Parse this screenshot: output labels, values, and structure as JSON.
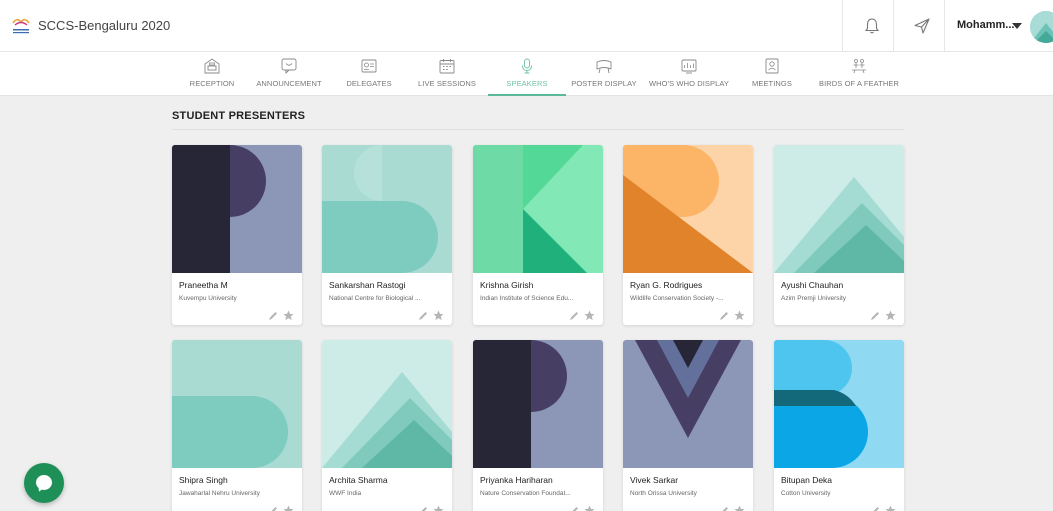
{
  "app": {
    "title": "SCCS-Bengaluru 2020",
    "logo_icon": "conference-logo-icon"
  },
  "header": {
    "user_name": "Mohamm...",
    "icons": [
      "bell-icon",
      "send-icon",
      "chevron-down-icon",
      "avatar"
    ]
  },
  "nav": {
    "items": [
      {
        "label": "RECEPTION",
        "icon": "reception-icon",
        "active": false
      },
      {
        "label": "ANNOUNCEMENT",
        "icon": "announcement-icon",
        "active": false
      },
      {
        "label": "DELEGATES",
        "icon": "delegates-icon",
        "active": false
      },
      {
        "label": "LIVE SESSIONS",
        "icon": "calendar-icon",
        "active": false
      },
      {
        "label": "SPEAKERS",
        "icon": "microphone-icon",
        "active": true
      },
      {
        "label": "POSTER DISPLAY",
        "icon": "poster-icon",
        "active": false
      },
      {
        "label": "WHO'S WHO DISPLAY",
        "icon": "display-icon",
        "active": false
      },
      {
        "label": "MEETINGS",
        "icon": "meetings-icon",
        "active": false
      },
      {
        "label": "BIRDS OF A FEATHER",
        "icon": "birds-icon",
        "active": false
      }
    ],
    "active_color": "#5bb89b"
  },
  "section": {
    "title": "STUDENT PRESENTERS"
  },
  "presenters": [
    {
      "name": "Praneetha M",
      "org": "Kuvempu University",
      "letter": "P",
      "palette": "p"
    },
    {
      "name": "Sankarshan Rastogi",
      "org": "National Centre for Biological ...",
      "letter": "S",
      "palette": "s"
    },
    {
      "name": "Krishna Girish",
      "org": "Indian Institute of Science Edu...",
      "letter": "K",
      "palette": "k"
    },
    {
      "name": "Ryan G. Rodrigues",
      "org": "Wildlife Conservation Society -...",
      "letter": "R",
      "palette": "r"
    },
    {
      "name": "Ayushi Chauhan",
      "org": "Azim Premji University",
      "letter": "A",
      "palette": "a"
    },
    {
      "name": "Shipra Singh",
      "org": "Jawaharlal Nehru University",
      "letter": "S",
      "palette": "s"
    },
    {
      "name": "Archita Sharma",
      "org": "WWF India",
      "letter": "A",
      "palette": "a"
    },
    {
      "name": "Priyanka Hariharan",
      "org": "Nature Conservation Foundat...",
      "letter": "P",
      "palette": "p"
    },
    {
      "name": "Vivek Sarkar",
      "org": "North Orissa University",
      "letter": "V",
      "palette": "v"
    },
    {
      "name": "Bitupan Deka",
      "org": "Cotton University",
      "letter": "B",
      "palette": "b"
    }
  ],
  "chat": {
    "icon": "chat-bubble-icon"
  }
}
